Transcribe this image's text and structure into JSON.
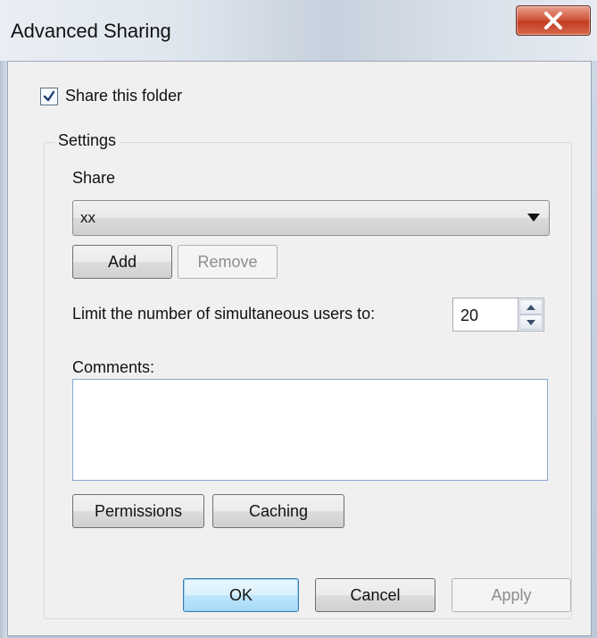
{
  "window": {
    "title": "Advanced Sharing",
    "close_icon": "close-icon"
  },
  "share_this_folder": {
    "label": "Share this folder",
    "checked": true
  },
  "settings": {
    "group_title": "Settings",
    "share_label": "Share",
    "share_value": "xx",
    "add_label": "Add",
    "remove_label": "Remove",
    "limit_label": "Limit the number of simultaneous users to:",
    "limit_value": "20",
    "comments_label": "Comments:",
    "comments_value": "",
    "permissions_label": "Permissions",
    "caching_label": "Caching"
  },
  "footer": {
    "ok_label": "OK",
    "cancel_label": "Cancel",
    "apply_label": "Apply"
  }
}
